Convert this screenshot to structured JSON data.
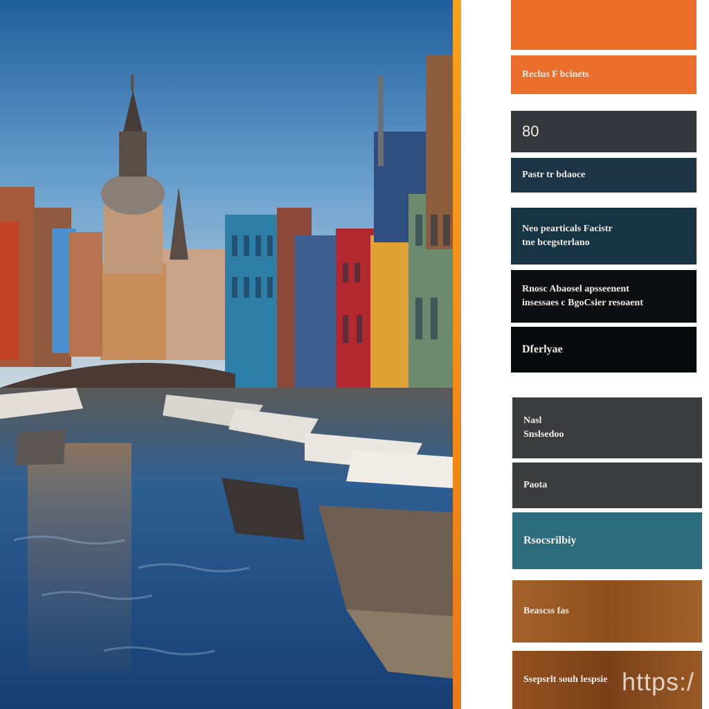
{
  "palette": {
    "swatches": [
      {
        "color": "#ea7028",
        "lines": []
      },
      {
        "color": "#e96f2a",
        "lines": [
          "Reclus F bcinets"
        ]
      },
      {
        "color": "#34373b",
        "lines": [
          "80"
        ]
      },
      {
        "color": "#1b3547",
        "lines": [
          "Pastr tr bdaoce"
        ]
      },
      {
        "color": "#173444",
        "lines": [
          "Neo pearticals Facistr",
          "tne bcegsterlano"
        ]
      },
      {
        "color": "#0d0f13",
        "lines": [
          "Rnosc Abaosel apsseenent",
          "insessaes c BgoCsier resoaent"
        ]
      },
      {
        "color": "#080a0d",
        "lines": [
          "Dferlyae"
        ]
      },
      {
        "color": "#3a3b3d",
        "lines": [
          "Nasl",
          "Snslsedoo"
        ]
      },
      {
        "color": "#3b3c3e",
        "lines": [
          "Paota"
        ]
      },
      {
        "color": "#2d6c7c",
        "lines": [
          "Rsocsrilbiy"
        ]
      },
      {
        "color": "#9a5a25",
        "lines": [
          "Beascss fas"
        ]
      },
      {
        "color": "#8f4d1f",
        "lines": [
          "Ssepsrlt souh lespsie"
        ]
      }
    ]
  },
  "watermark": {
    "text": "https:/"
  }
}
